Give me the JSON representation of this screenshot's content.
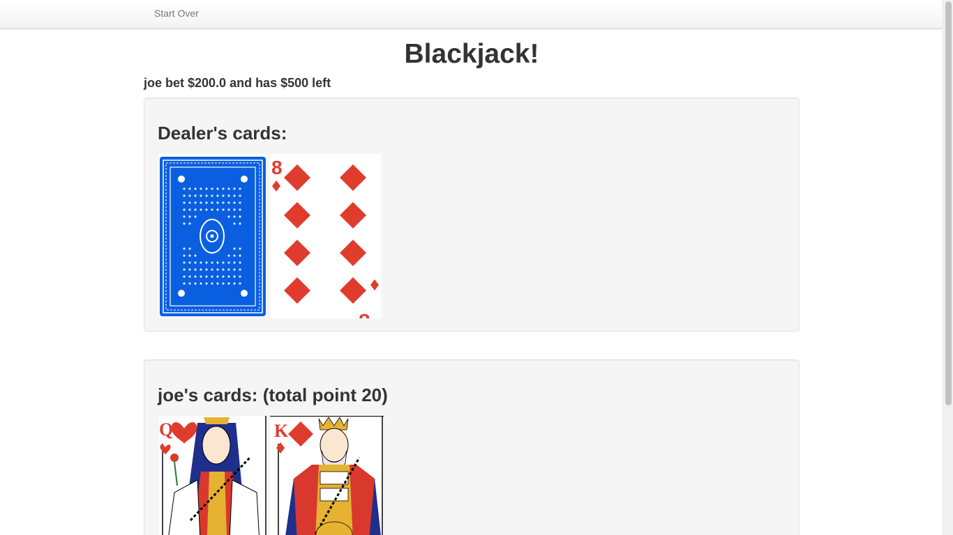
{
  "nav": {
    "start_over": "Start Over"
  },
  "title": "Blackjack!",
  "bet_line": "joe bet $200.0 and has $500 left",
  "dealer": {
    "heading": "Dealer's cards:",
    "cards": [
      {
        "face": "back",
        "color": "#0a5fe0"
      },
      {
        "face": "8-of-diamonds",
        "rank": "8",
        "suit": "♦"
      }
    ]
  },
  "player": {
    "heading": "joe's cards: (total point 20)",
    "cards": [
      {
        "face": "queen-of-hearts",
        "rank": "Q",
        "suit": "♥"
      },
      {
        "face": "king-of-diamonds",
        "rank": "K",
        "suit": "♦"
      }
    ]
  },
  "colors": {
    "red_suit": "#e03c2e",
    "card_back": "#0a5fe0",
    "well": "#f5f5f5"
  }
}
